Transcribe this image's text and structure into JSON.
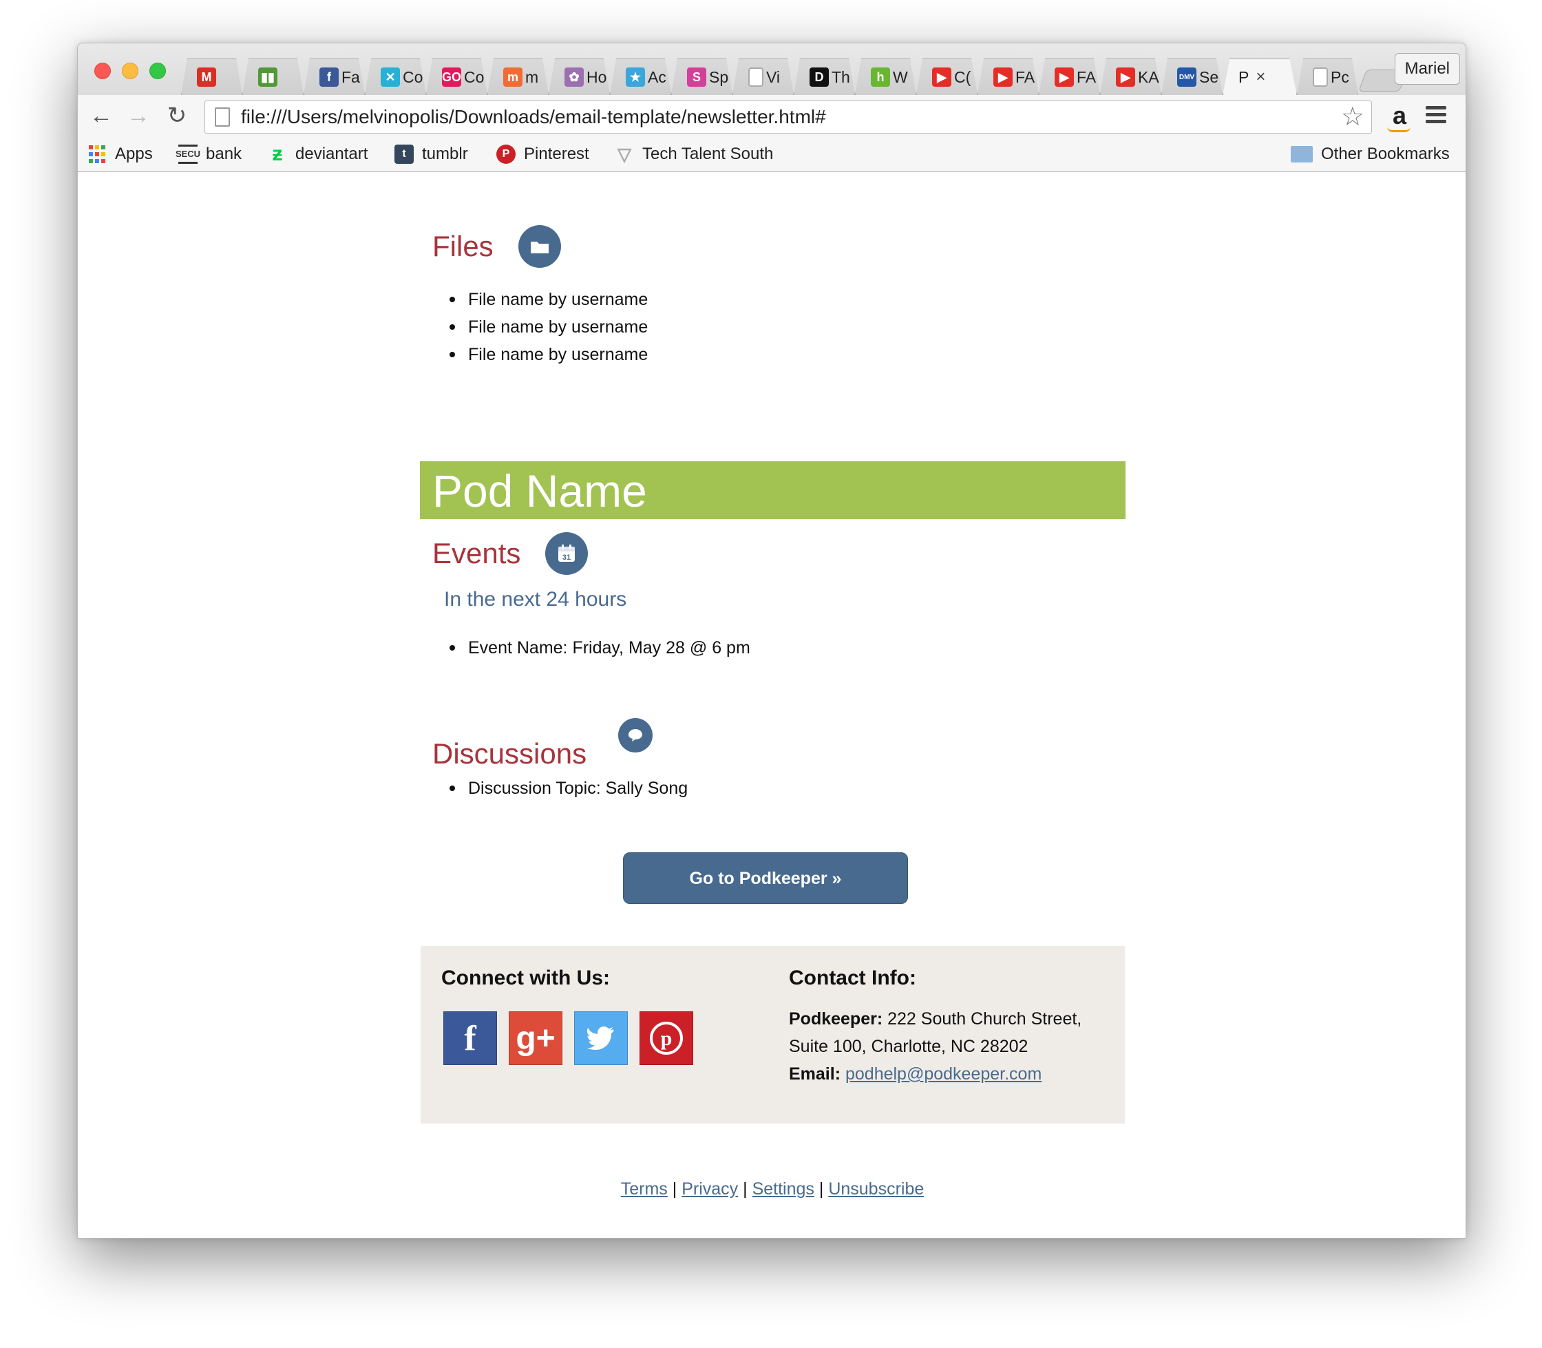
{
  "browser": {
    "profile": "Mariel",
    "url": "file:///Users/melvinopolis/Downloads/email-template/newsletter.html#",
    "tabs": [
      {
        "label": "",
        "icon": "gmail-icon",
        "color": "#d93025",
        "glyph": "M"
      },
      {
        "label": "",
        "icon": "trello-icon",
        "color": "#519839",
        "glyph": "▮▮"
      },
      {
        "label": "Fa",
        "icon": "facebook-icon",
        "color": "#3b5998",
        "glyph": "f"
      },
      {
        "label": "Co",
        "icon": "codeacademy-icon",
        "color": "#27b1d4",
        "glyph": "✕"
      },
      {
        "label": "Co",
        "icon": "go-icon",
        "color": "#e2195d",
        "glyph": "GO"
      },
      {
        "label": "m",
        "icon": "meetup-icon",
        "color": "#ef6c35",
        "glyph": "m"
      },
      {
        "label": "Ho",
        "icon": "flower-icon",
        "color": "#9b6fb0",
        "glyph": "✿"
      },
      {
        "label": "Ac",
        "icon": "star-icon",
        "color": "#3aa6d9",
        "glyph": "★"
      },
      {
        "label": "Sp",
        "icon": "spotify-icon",
        "color": "#d3409a",
        "glyph": "S"
      },
      {
        "label": "Vi",
        "icon": "page-icon",
        "color": "#ffffff",
        "glyph": ""
      },
      {
        "label": "Th",
        "icon": "d-icon",
        "color": "#111111",
        "glyph": "D"
      },
      {
        "label": "W",
        "icon": "houzz-icon",
        "color": "#69b631",
        "glyph": "h"
      },
      {
        "label": "C(",
        "icon": "youtube-icon",
        "color": "#e52d27",
        "glyph": "▶"
      },
      {
        "label": "FA",
        "icon": "youtube-icon",
        "color": "#e52d27",
        "glyph": "▶"
      },
      {
        "label": "FA",
        "icon": "youtube-icon",
        "color": "#e52d27",
        "glyph": "▶"
      },
      {
        "label": "KA",
        "icon": "youtube-icon",
        "color": "#e52d27",
        "glyph": "▶"
      },
      {
        "label": "Se",
        "icon": "dmv-icon",
        "color": "#2457a5",
        "glyph": "DMV"
      },
      {
        "label": "P",
        "icon": "",
        "color": "",
        "glyph": "",
        "active": true
      },
      {
        "label": "Pc",
        "icon": "page-icon",
        "color": "#ffffff",
        "glyph": ""
      }
    ],
    "bookmarks": [
      {
        "label": "Apps",
        "icon": "apps-grid-icon"
      },
      {
        "label": "bank",
        "icon": "secu-icon"
      },
      {
        "label": "deviantart",
        "icon": "deviantart-icon"
      },
      {
        "label": "tumblr",
        "icon": "tumblr-icon"
      },
      {
        "label": "Pinterest",
        "icon": "pinterest-icon"
      },
      {
        "label": "Tech Talent South",
        "icon": "v-icon"
      },
      {
        "label": "Other Bookmarks",
        "icon": "folder-icon"
      }
    ]
  },
  "newsletter": {
    "files": {
      "title": "Files",
      "items": [
        "File name by username",
        "File name by username",
        "File name by username"
      ]
    },
    "pod_name": "Pod Name",
    "events": {
      "title": "Events",
      "subtitle": "In the next 24 hours",
      "items": [
        "Event Name: Friday, May 28 @ 6 pm"
      ]
    },
    "discussions": {
      "title": "Discussions",
      "items": [
        "Discussion Topic: Sally Song"
      ]
    },
    "cta_label": "Go to Podkeeper »",
    "footer": {
      "connect_title": "Connect with Us:",
      "contact_title": "Contact Info:",
      "company_label": "Podkeeper:",
      "address_line1": "222 South Church Street,",
      "address_line2": "Suite 100, Charlotte, NC 28202",
      "email_label": "Email:",
      "email": "podhelp@podkeeper.com",
      "social": [
        {
          "name": "facebook",
          "glyph": "f",
          "color": "#3b5998"
        },
        {
          "name": "google-plus",
          "glyph": "g+",
          "color": "#dd4b39"
        },
        {
          "name": "twitter",
          "glyph": "🐦",
          "color": "#55acee"
        },
        {
          "name": "pinterest",
          "glyph": "P",
          "color": "#cb2027"
        }
      ]
    },
    "legal_links": [
      "Terms",
      "Privacy",
      "Settings",
      "Unsubscribe"
    ],
    "legal_separator": "|"
  },
  "colors": {
    "accent_red": "#a8343b",
    "accent_blue": "#486a8f",
    "pod_green": "#a2c251",
    "footer_bg": "#efece8"
  }
}
